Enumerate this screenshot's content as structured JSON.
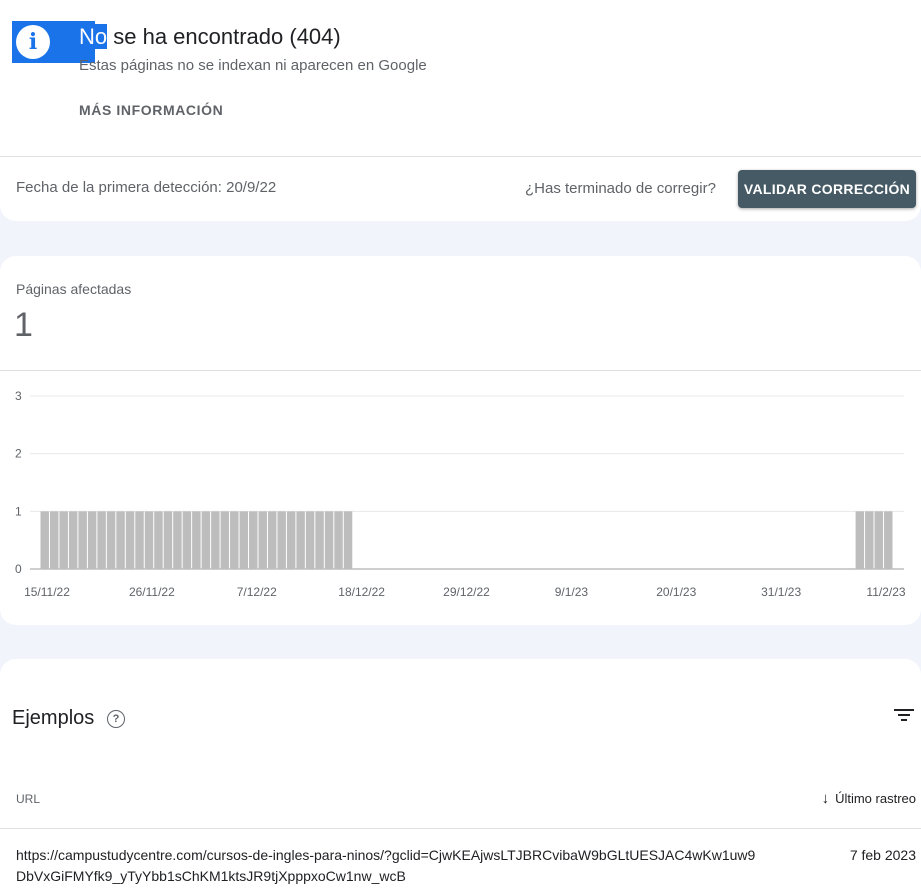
{
  "issue": {
    "title_highlight": "No",
    "title_rest": " se ha encontrado (404)",
    "subtitle": "Estas páginas no se indexan ni aparecen en Google",
    "more_info": "MÁS INFORMACIÓN",
    "icon": "info-icon",
    "first_detection": "Fecha de la primera detección: 20/9/22",
    "fix_question": "¿Has terminado de corregir?",
    "validate_button": "VALIDAR CORRECCIÓN"
  },
  "summary": {
    "label": "Páginas afectadas",
    "count": "1"
  },
  "chart_data": {
    "type": "bar",
    "y_ticks": [
      "0",
      "1",
      "2",
      "3"
    ],
    "ylim": [
      0,
      3
    ],
    "x_tick_labels": [
      "15/11/22",
      "26/11/22",
      "7/12/22",
      "18/12/22",
      "29/12/22",
      "9/1/23",
      "20/1/23",
      "31/1/23",
      "11/2/23"
    ],
    "x_start_date": "15/11/22",
    "x_end_date": "12/2/23",
    "series": [
      {
        "values": [
          1,
          1,
          1,
          1,
          1,
          1,
          1,
          1,
          1,
          1,
          1,
          1,
          1,
          1,
          1,
          1,
          1,
          1,
          1,
          1,
          1,
          1,
          1,
          1,
          1,
          1,
          1,
          1,
          1,
          1,
          1,
          1,
          1,
          0,
          0,
          0,
          0,
          0,
          0,
          0,
          0,
          0,
          0,
          0,
          0,
          0,
          0,
          0,
          0,
          0,
          0,
          0,
          0,
          0,
          0,
          0,
          0,
          0,
          0,
          0,
          0,
          0,
          0,
          0,
          0,
          0,
          0,
          0,
          0,
          0,
          0,
          0,
          0,
          0,
          0,
          0,
          0,
          0,
          0,
          0,
          0,
          0,
          0,
          0,
          0,
          0,
          1,
          1,
          1,
          1
        ],
        "color": "#bdbdbd"
      }
    ],
    "grid": true
  },
  "examples": {
    "title": "Ejemplos",
    "help_icon": "help-icon",
    "filter_icon": "filter-icon",
    "col_url": "URL",
    "col_last_crawl": "Último rastreo",
    "sort_icon": "arrow-down-icon",
    "rows": [
      {
        "url": "https://campustudycentre.com/cursos-de-ingles-para-ninos/?gclid=CjwKEAjwsLTJBRCvibaW9bGLtUESJAC4wKw1uw9DbVxGiFMYfk9_yTyYbb1sChKM1ktsJR9tjXpppxoCw1nw_wcB",
        "date": "7 feb 2023"
      }
    ]
  }
}
